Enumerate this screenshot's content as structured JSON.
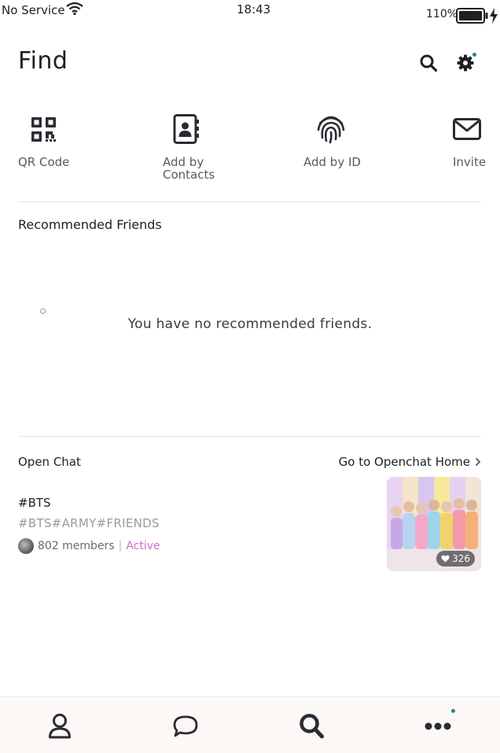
{
  "status_bar": {
    "carrier": "No Service",
    "time": "18:43",
    "battery_percent": "110%"
  },
  "header": {
    "title": "Find"
  },
  "actions": [
    {
      "label": "QR Code",
      "icon": "qr-code-icon"
    },
    {
      "label": "Add by\nContacts",
      "icon": "contacts-book-icon"
    },
    {
      "label": "Add by ID",
      "icon": "fingerprint-icon"
    },
    {
      "label": "Invite",
      "icon": "envelope-icon"
    }
  ],
  "recommended": {
    "title": "Recommended Friends",
    "empty_message": "You have no recommended friends."
  },
  "open_chat": {
    "title": "Open Chat",
    "home_link": "Go to Openchat Home",
    "item": {
      "name": "#BTS",
      "tags": "#BTS#ARMY#FRIENDS",
      "members": "802 members",
      "status": "Active",
      "likes": "326"
    }
  },
  "bottom_nav": [
    {
      "icon": "person-icon"
    },
    {
      "icon": "chat-bubble-icon"
    },
    {
      "icon": "search-icon"
    },
    {
      "icon": "more-icon"
    }
  ],
  "colors": {
    "accent_dot": "#1d8a8a",
    "active_status": "#d46ac8",
    "icon_dark": "#2b2b33"
  }
}
